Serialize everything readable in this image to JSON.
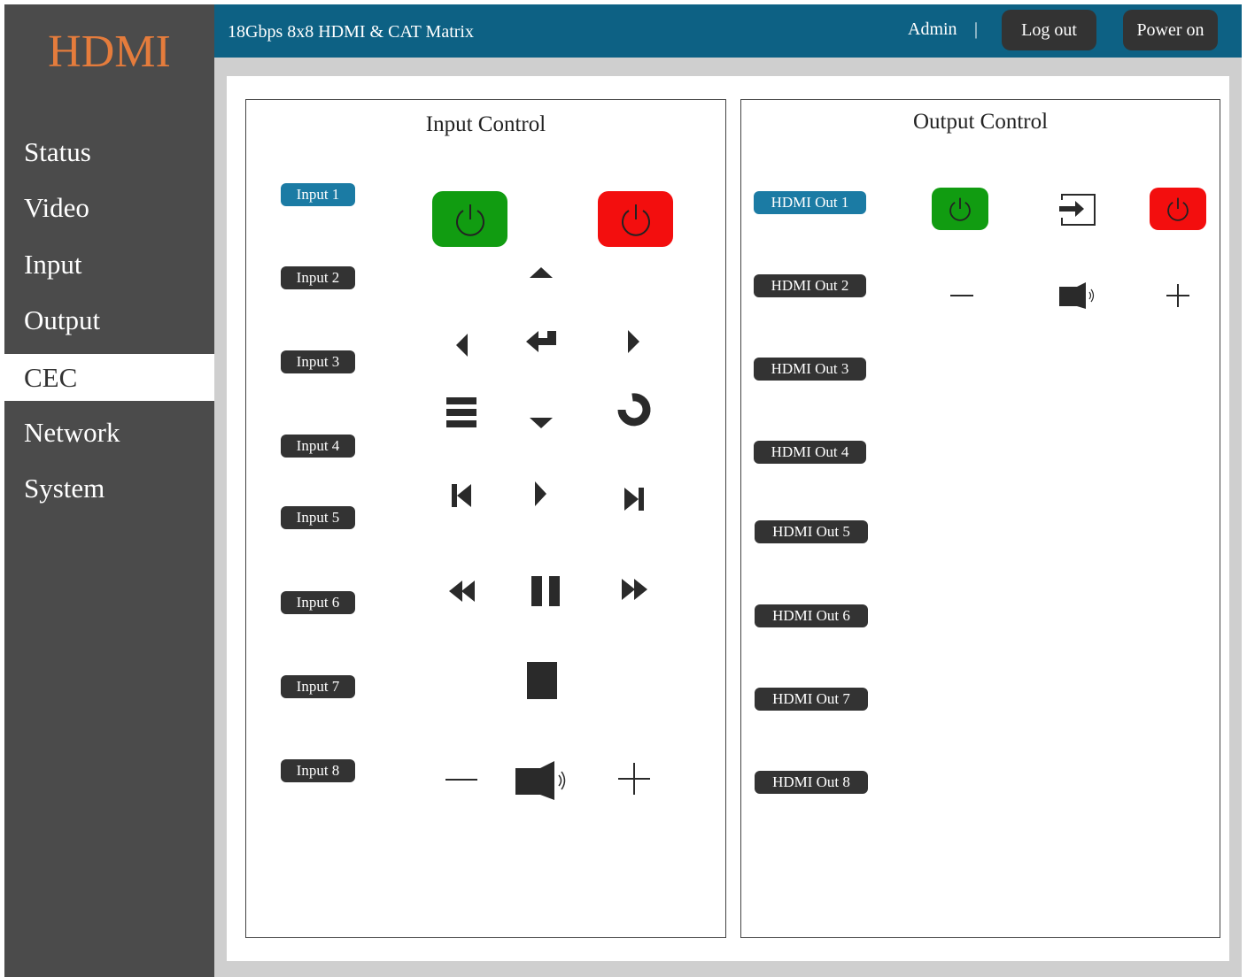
{
  "logo": "HDMI",
  "app_title": "18Gbps 8x8 HDMI & CAT Matrix",
  "user": "Admin",
  "separator": "|",
  "buttons": {
    "logout": "Log out",
    "power_on": "Power on"
  },
  "nav": [
    "Status",
    "Video",
    "Input",
    "Output",
    "CEC",
    "Network",
    "System"
  ],
  "active_nav": "CEC",
  "input_panel": {
    "title": "Input Control",
    "inputs": [
      "Input 1",
      "Input 2",
      "Input 3",
      "Input 4",
      "Input 5",
      "Input 6",
      "Input 7",
      "Input 8"
    ],
    "selected": "Input 1",
    "controls": [
      "power-on",
      "power-off",
      "up",
      "left",
      "enter",
      "right",
      "menu",
      "down",
      "back",
      "previous",
      "play",
      "next",
      "rewind",
      "pause",
      "fast-forward",
      "stop",
      "volume-down",
      "mute",
      "volume-up"
    ]
  },
  "output_panel": {
    "title": "Output Control",
    "outputs": [
      "HDMI Out 1",
      "HDMI Out 2",
      "HDMI Out 3",
      "HDMI Out 4",
      "HDMI Out 5",
      "HDMI Out 6",
      "HDMI Out 7",
      "HDMI Out 8"
    ],
    "selected": "HDMI Out 1",
    "controls": [
      "power-on",
      "source-input",
      "power-off",
      "volume-down",
      "mute",
      "volume-up"
    ]
  },
  "colors": {
    "accent": "#0d6184",
    "sidebar": "#4b4b4b",
    "logo": "#e57c3c",
    "power_on": "#119c11",
    "power_off": "#f30e0e",
    "selected_pill": "#1b7ba4"
  }
}
